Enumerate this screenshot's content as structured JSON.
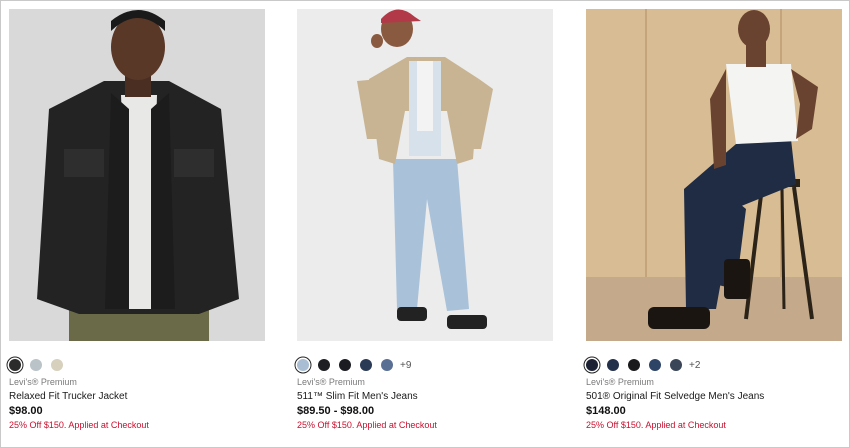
{
  "products": [
    {
      "brand": "Levi's® Premium",
      "name": "Relaxed Fit Trucker Jacket",
      "price": "$98.00",
      "promo": "25% Off $150. Applied at Checkout",
      "swatch_colors": [
        "#2b2b2b",
        "#b9c3c8",
        "#d6d0bd"
      ],
      "more_colors": ""
    },
    {
      "brand": "Levi's® Premium",
      "name": "511™ Slim Fit Men's Jeans",
      "price": "$89.50 - $98.00",
      "promo": "25% Off $150. Applied at Checkout",
      "swatch_colors": [
        "#a9bed3",
        "#1e1f23",
        "#1b1c21",
        "#2b3b55",
        "#5a6f94"
      ],
      "more_colors": "+9"
    },
    {
      "brand": "Levi's® Premium",
      "name": "501® Original Fit Selvedge Men's Jeans",
      "price": "$148.00",
      "promo": "25% Off $150. Applied at Checkout",
      "swatch_colors": [
        "#1c2233",
        "#23304a",
        "#1a1a1c",
        "#2e4466",
        "#3a4658"
      ],
      "more_colors": "+2"
    }
  ],
  "colors": {
    "promo": "#c8102e",
    "brand_text": "#7a7a7a"
  }
}
